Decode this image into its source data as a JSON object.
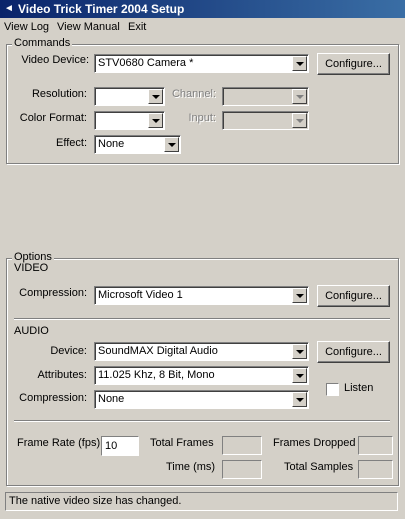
{
  "window": {
    "title": "Video Trick Timer 2004 Setup"
  },
  "menu": {
    "view_log": "View Log",
    "view_manual": "View Manual",
    "exit": "Exit"
  },
  "commands": {
    "legend": "Commands",
    "video_device_label": "Video Device:",
    "video_device_value": "STV0680 Camera *",
    "configure_label": "Configure...",
    "resolution_label": "Resolution:",
    "resolution_value": "",
    "channel_label": "Channel:",
    "color_format_label": "Color Format:",
    "color_format_value": "",
    "input_label": "Input:",
    "effect_label": "Effect:",
    "effect_value": "None"
  },
  "options": {
    "legend": "Options",
    "video_heading": "VIDEO",
    "compression_label": "Compression:",
    "video_compression_value": "Microsoft Video 1",
    "configure_label": "Configure...",
    "audio_heading": "AUDIO",
    "device_label": "Device:",
    "audio_device_value": "SoundMAX Digital Audio",
    "attributes_label": "Attributes:",
    "attributes_value": "11.025 Khz, 8 Bit, Mono",
    "listen_label": "Listen",
    "audio_compression_value": "None",
    "frame_rate_label": "Frame Rate (fps)",
    "frame_rate_value": "10",
    "total_frames_label": "Total Frames",
    "frames_dropped_label": "Frames Dropped",
    "time_label": "Time (ms)",
    "total_samples_label": "Total Samples"
  },
  "status": {
    "text": "The native video size has changed."
  }
}
